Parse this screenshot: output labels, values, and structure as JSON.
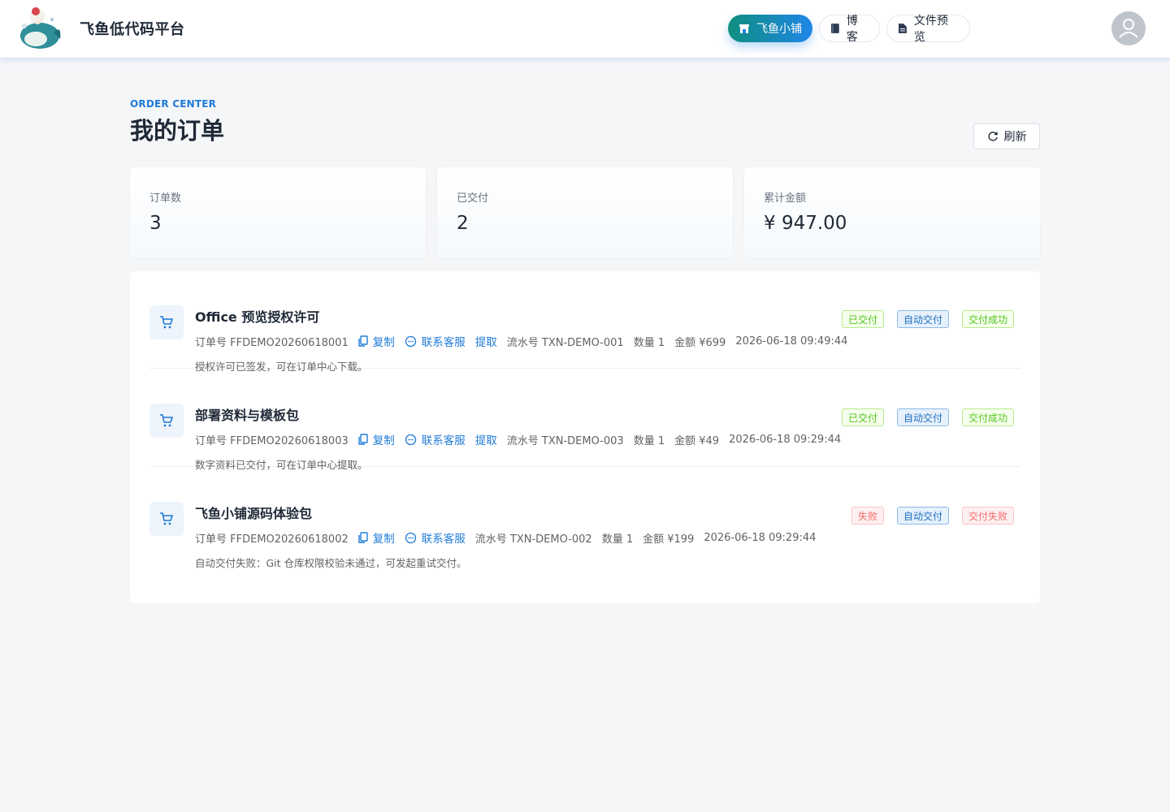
{
  "header": {
    "brand": "飞鱼低代码平台",
    "nav": [
      {
        "label": "飞鱼小铺",
        "active": true
      },
      {
        "label": "博客",
        "active": false
      },
      {
        "label": "文件预览",
        "active": false
      }
    ]
  },
  "page": {
    "eyebrow": "ORDER CENTER",
    "title": "我的订单",
    "refresh_label": "刷新"
  },
  "stats": [
    {
      "label": "订单数",
      "value": "3"
    },
    {
      "label": "已交付",
      "value": "2"
    },
    {
      "label": "累计金额",
      "value": "¥ 947.00"
    }
  ],
  "orders": [
    {
      "name": "Office 预览授权许可",
      "order_no": "订单号 FFDEMO20260618001",
      "copy": "复制",
      "contact": "联系客服",
      "extract": "提取",
      "txn": "流水号 TXN-DEMO-001",
      "qty": "数量 1",
      "amount": "金额 ¥699",
      "time": "2026-06-18 09:49:44",
      "desc": "授权许可已签发，可在订单中心下载。",
      "tags": [
        {
          "label": "已交付",
          "color": "green"
        },
        {
          "label": "自动交付",
          "color": "blue"
        },
        {
          "label": "交付成功",
          "color": "green"
        }
      ]
    },
    {
      "name": "部署资料与模板包",
      "order_no": "订单号 FFDEMO20260618003",
      "copy": "复制",
      "contact": "联系客服",
      "extract": "提取",
      "txn": "流水号 TXN-DEMO-003",
      "qty": "数量 1",
      "amount": "金额 ¥49",
      "time": "2026-06-18 09:29:44",
      "desc": "数字资料已交付，可在订单中心提取。",
      "tags": [
        {
          "label": "已交付",
          "color": "green"
        },
        {
          "label": "自动交付",
          "color": "blue"
        },
        {
          "label": "交付成功",
          "color": "green"
        }
      ]
    },
    {
      "name": "飞鱼小铺源码体验包",
      "order_no": "订单号 FFDEMO20260618002",
      "copy": "复制",
      "contact": "联系客服",
      "txn": "流水号 TXN-DEMO-002",
      "qty": "数量 1",
      "amount": "金额 ¥199",
      "time": "2026-06-18 09:29:44",
      "desc": "自动交付失败：Git 仓库权限校验未通过，可发起重试交付。",
      "tags": [
        {
          "label": "失败",
          "color": "red"
        },
        {
          "label": "自动交付",
          "color": "blue"
        },
        {
          "label": "交付失败",
          "color": "red"
        }
      ]
    }
  ]
}
